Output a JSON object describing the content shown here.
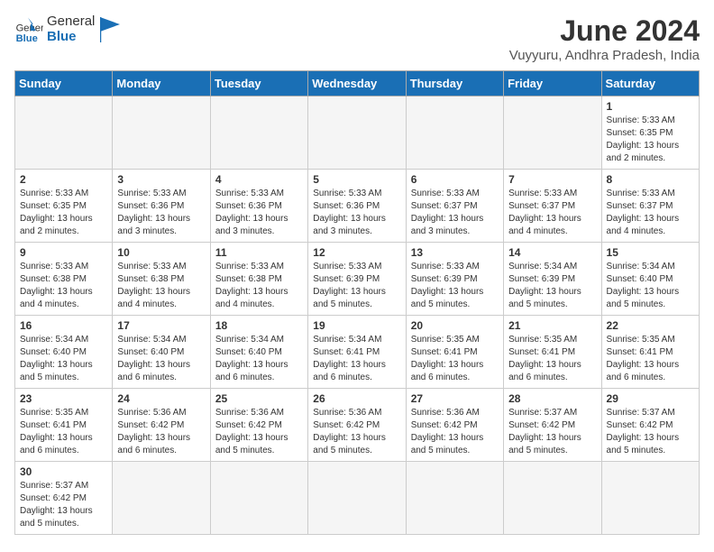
{
  "logo": {
    "text_general": "General",
    "text_blue": "Blue"
  },
  "title": "June 2024",
  "subtitle": "Vuyyuru, Andhra Pradesh, India",
  "weekdays": [
    "Sunday",
    "Monday",
    "Tuesday",
    "Wednesday",
    "Thursday",
    "Friday",
    "Saturday"
  ],
  "weeks": [
    [
      {
        "day": "",
        "empty": true
      },
      {
        "day": "",
        "empty": true
      },
      {
        "day": "",
        "empty": true
      },
      {
        "day": "",
        "empty": true
      },
      {
        "day": "",
        "empty": true
      },
      {
        "day": "",
        "empty": true
      },
      {
        "day": "1",
        "info": "Sunrise: 5:33 AM\nSunset: 6:35 PM\nDaylight: 13 hours\nand 2 minutes."
      }
    ],
    [
      {
        "day": "2",
        "info": "Sunrise: 5:33 AM\nSunset: 6:35 PM\nDaylight: 13 hours\nand 2 minutes."
      },
      {
        "day": "3",
        "info": "Sunrise: 5:33 AM\nSunset: 6:36 PM\nDaylight: 13 hours\nand 3 minutes."
      },
      {
        "day": "4",
        "info": "Sunrise: 5:33 AM\nSunset: 6:36 PM\nDaylight: 13 hours\nand 3 minutes."
      },
      {
        "day": "5",
        "info": "Sunrise: 5:33 AM\nSunset: 6:36 PM\nDaylight: 13 hours\nand 3 minutes."
      },
      {
        "day": "6",
        "info": "Sunrise: 5:33 AM\nSunset: 6:37 PM\nDaylight: 13 hours\nand 3 minutes."
      },
      {
        "day": "7",
        "info": "Sunrise: 5:33 AM\nSunset: 6:37 PM\nDaylight: 13 hours\nand 4 minutes."
      },
      {
        "day": "8",
        "info": "Sunrise: 5:33 AM\nSunset: 6:37 PM\nDaylight: 13 hours\nand 4 minutes."
      }
    ],
    [
      {
        "day": "9",
        "info": "Sunrise: 5:33 AM\nSunset: 6:38 PM\nDaylight: 13 hours\nand 4 minutes."
      },
      {
        "day": "10",
        "info": "Sunrise: 5:33 AM\nSunset: 6:38 PM\nDaylight: 13 hours\nand 4 minutes."
      },
      {
        "day": "11",
        "info": "Sunrise: 5:33 AM\nSunset: 6:38 PM\nDaylight: 13 hours\nand 4 minutes."
      },
      {
        "day": "12",
        "info": "Sunrise: 5:33 AM\nSunset: 6:39 PM\nDaylight: 13 hours\nand 5 minutes."
      },
      {
        "day": "13",
        "info": "Sunrise: 5:33 AM\nSunset: 6:39 PM\nDaylight: 13 hours\nand 5 minutes."
      },
      {
        "day": "14",
        "info": "Sunrise: 5:34 AM\nSunset: 6:39 PM\nDaylight: 13 hours\nand 5 minutes."
      },
      {
        "day": "15",
        "info": "Sunrise: 5:34 AM\nSunset: 6:40 PM\nDaylight: 13 hours\nand 5 minutes."
      }
    ],
    [
      {
        "day": "16",
        "info": "Sunrise: 5:34 AM\nSunset: 6:40 PM\nDaylight: 13 hours\nand 5 minutes."
      },
      {
        "day": "17",
        "info": "Sunrise: 5:34 AM\nSunset: 6:40 PM\nDaylight: 13 hours\nand 6 minutes."
      },
      {
        "day": "18",
        "info": "Sunrise: 5:34 AM\nSunset: 6:40 PM\nDaylight: 13 hours\nand 6 minutes."
      },
      {
        "day": "19",
        "info": "Sunrise: 5:34 AM\nSunset: 6:41 PM\nDaylight: 13 hours\nand 6 minutes."
      },
      {
        "day": "20",
        "info": "Sunrise: 5:35 AM\nSunset: 6:41 PM\nDaylight: 13 hours\nand 6 minutes."
      },
      {
        "day": "21",
        "info": "Sunrise: 5:35 AM\nSunset: 6:41 PM\nDaylight: 13 hours\nand 6 minutes."
      },
      {
        "day": "22",
        "info": "Sunrise: 5:35 AM\nSunset: 6:41 PM\nDaylight: 13 hours\nand 6 minutes."
      }
    ],
    [
      {
        "day": "23",
        "info": "Sunrise: 5:35 AM\nSunset: 6:41 PM\nDaylight: 13 hours\nand 6 minutes."
      },
      {
        "day": "24",
        "info": "Sunrise: 5:36 AM\nSunset: 6:42 PM\nDaylight: 13 hours\nand 6 minutes."
      },
      {
        "day": "25",
        "info": "Sunrise: 5:36 AM\nSunset: 6:42 PM\nDaylight: 13 hours\nand 5 minutes."
      },
      {
        "day": "26",
        "info": "Sunrise: 5:36 AM\nSunset: 6:42 PM\nDaylight: 13 hours\nand 5 minutes."
      },
      {
        "day": "27",
        "info": "Sunrise: 5:36 AM\nSunset: 6:42 PM\nDaylight: 13 hours\nand 5 minutes."
      },
      {
        "day": "28",
        "info": "Sunrise: 5:37 AM\nSunset: 6:42 PM\nDaylight: 13 hours\nand 5 minutes."
      },
      {
        "day": "29",
        "info": "Sunrise: 5:37 AM\nSunset: 6:42 PM\nDaylight: 13 hours\nand 5 minutes."
      }
    ],
    [
      {
        "day": "30",
        "info": "Sunrise: 5:37 AM\nSunset: 6:42 PM\nDaylight: 13 hours\nand 5 minutes."
      },
      {
        "day": "",
        "empty": true
      },
      {
        "day": "",
        "empty": true
      },
      {
        "day": "",
        "empty": true
      },
      {
        "day": "",
        "empty": true
      },
      {
        "day": "",
        "empty": true
      },
      {
        "day": "",
        "empty": true
      }
    ]
  ]
}
